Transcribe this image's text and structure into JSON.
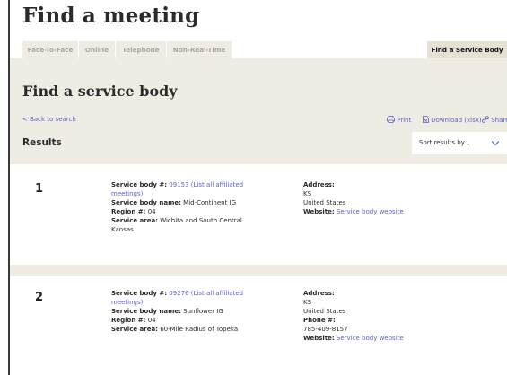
{
  "header": {
    "title": "Find a meeting"
  },
  "tabs": [
    {
      "label": "Face-To-Face"
    },
    {
      "label": "Online"
    },
    {
      "label": "Telephone"
    },
    {
      "label": "Non-Real-Time"
    },
    {
      "label": "Find a Service Body",
      "active": true
    }
  ],
  "section": {
    "title": "Find a service body",
    "back_link": "< Back to search",
    "actions": {
      "print": "Print",
      "download": "Download (xlsx)",
      "share": "Share link"
    },
    "results_label": "Results",
    "sort": {
      "value": "Sort results by..."
    }
  },
  "results": [
    {
      "index": "1",
      "service_body_label": "Service body #:",
      "service_body_number": "09153",
      "affiliated_link": "(List all affiliated meetings)",
      "name_label": "Service body name:",
      "name": "Mid-Continent IG",
      "region_label": "Region #:",
      "region": "04",
      "area_label": "Service area:",
      "area": "Wichita and South Central Kansas",
      "address_label": "Address:",
      "address_lines": [
        "KS",
        "United States"
      ],
      "website_label": "Website:",
      "website_link": "Service body website"
    },
    {
      "index": "2",
      "service_body_label": "Service body #:",
      "service_body_number": "09276",
      "affiliated_link": "(List all affiliated meetings)",
      "name_label": "Service body name:",
      "name": "Sunflower IG",
      "region_label": "Region #:",
      "region": "04",
      "area_label": "Service area:",
      "area": "60-Mile Radius of Topeka",
      "address_label": "Address:",
      "address_lines": [
        "KS",
        "United States"
      ],
      "phone_label": "Phone #:",
      "phone": "785-409-8157",
      "website_label": "Website:",
      "website_link": "Service body website"
    }
  ],
  "icons": {
    "print": "printer-icon",
    "download": "download-icon",
    "share": "link-icon",
    "sort": "chevron-down-icon"
  },
  "colors": {
    "panel_bg": "#efece3",
    "tab_active_bg": "#e5e1d3",
    "link": "#5a5fc6",
    "text": "#2b2b2b"
  }
}
